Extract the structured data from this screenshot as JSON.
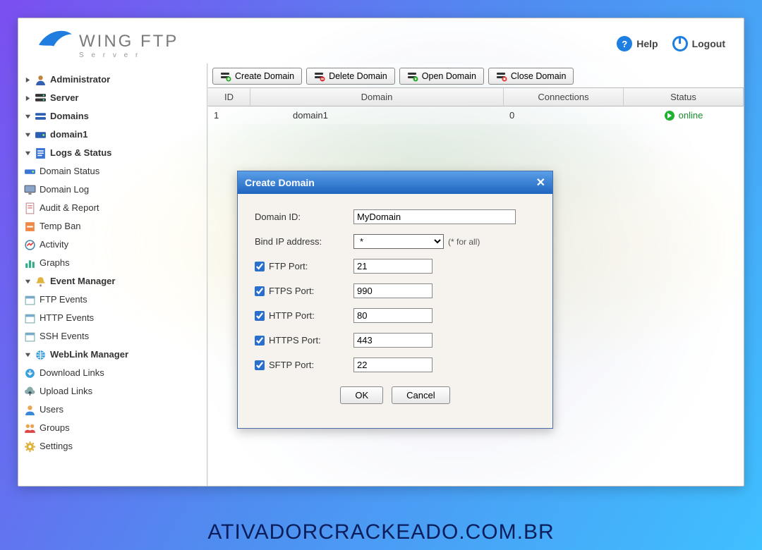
{
  "brand": {
    "name": "WING FTP",
    "subtitle": "S e r v e r"
  },
  "header": {
    "help": "Help",
    "logout": "Logout"
  },
  "tree": {
    "administrator": "Administrator",
    "server": "Server",
    "domains": "Domains",
    "domain1": "domain1",
    "logs_status": "Logs & Status",
    "domain_status": "Domain Status",
    "domain_log": "Domain Log",
    "audit_report": "Audit & Report",
    "temp_ban": "Temp Ban",
    "activity": "Activity",
    "graphs": "Graphs",
    "event_manager": "Event Manager",
    "ftp_events": "FTP Events",
    "http_events": "HTTP Events",
    "ssh_events": "SSH Events",
    "weblink_manager": "WebLink Manager",
    "download_links": "Download Links",
    "upload_links": "Upload Links",
    "users": "Users",
    "groups": "Groups",
    "settings": "Settings"
  },
  "toolbar": {
    "create": "Create Domain",
    "delete": "Delete Domain",
    "open": "Open Domain",
    "close": "Close Domain"
  },
  "table": {
    "head": {
      "id": "ID",
      "domain": "Domain",
      "connections": "Connections",
      "status": "Status"
    },
    "rows": [
      {
        "id": "1",
        "domain": "domain1",
        "connections": "0",
        "status": "online"
      }
    ]
  },
  "modal": {
    "title": "Create Domain",
    "domain_id_label": "Domain ID:",
    "domain_id_value": "MyDomain",
    "bind_ip_label": "Bind IP address:",
    "bind_ip_value": "*",
    "bind_ip_hint": "(* for all)",
    "ftp_label": "FTP Port:",
    "ftp_value": "21",
    "ftp_checked": true,
    "ftps_label": "FTPS Port:",
    "ftps_value": "990",
    "ftps_checked": true,
    "http_label": "HTTP Port:",
    "http_value": "80",
    "http_checked": true,
    "https_label": "HTTPS Port:",
    "https_value": "443",
    "https_checked": true,
    "sftp_label": "SFTP Port:",
    "sftp_value": "22",
    "sftp_checked": true,
    "ok": "OK",
    "cancel": "Cancel"
  },
  "watermark": "ATIVADORCRACKEADO.COM.BR"
}
